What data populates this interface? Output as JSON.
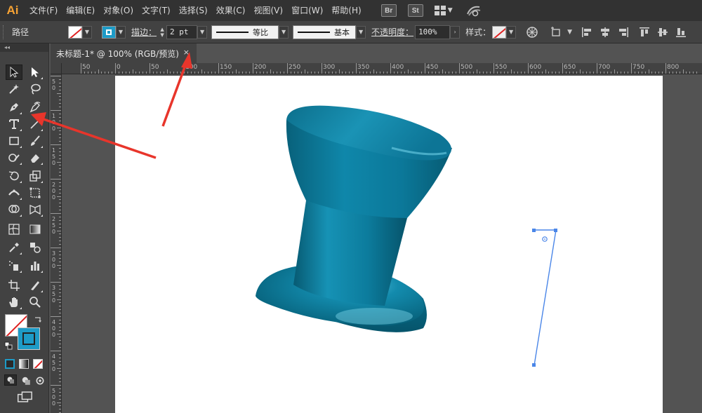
{
  "app": {
    "logo": "Ai"
  },
  "menu": [
    {
      "key": "file",
      "label": "文件(F)"
    },
    {
      "key": "edit",
      "label": "编辑(E)"
    },
    {
      "key": "object",
      "label": "对象(O)"
    },
    {
      "key": "type",
      "label": "文字(T)"
    },
    {
      "key": "select",
      "label": "选择(S)"
    },
    {
      "key": "effect",
      "label": "效果(C)"
    },
    {
      "key": "view",
      "label": "视图(V)"
    },
    {
      "key": "window",
      "label": "窗口(W)"
    },
    {
      "key": "help",
      "label": "帮助(H)"
    }
  ],
  "bridge": {
    "br": "Br",
    "st": "St"
  },
  "control": {
    "selection_label": "路径",
    "stroke_label": "描边",
    "stroke_weight": "2 pt",
    "profile_label": "等比",
    "brush_label": "基本",
    "opacity_label": "不透明度",
    "opacity_value": "100%",
    "style_label": "样式"
  },
  "tab": {
    "title": "未标题-1* @ 100% (RGB/预览)",
    "close": "×"
  },
  "rulers": {
    "h_ticks": [
      "50",
      "0",
      "50",
      "100",
      "150",
      "200",
      "250",
      "300",
      "350",
      "400",
      "450",
      "500",
      "550",
      "600",
      "650",
      "700",
      "750",
      "800"
    ],
    "v_ticks": [
      "5\n0",
      "1\n0\n0",
      "1\n5\n0",
      "2\n0\n0",
      "2\n5\n0",
      "3\n0\n0",
      "3\n5\n0",
      "4\n0\n0",
      "4\n5\n0",
      "5\n0\n0"
    ]
  },
  "colors": {
    "accent_fill": "#1d9bc7",
    "shape_primary": "#0a7fa0",
    "shape_dark": "#065f78",
    "shape_light": "#4fb7d3",
    "selection": "#4a86e8",
    "arrow_red": "#e8352b"
  },
  "tools": [
    {
      "name": "selection-tool-icon"
    },
    {
      "name": "direct-selection-tool-icon"
    },
    {
      "name": "magic-wand-tool-icon"
    },
    {
      "name": "lasso-tool-icon"
    },
    {
      "name": "pen-tool-icon"
    },
    {
      "name": "curvature-tool-icon"
    },
    {
      "name": "type-tool-icon"
    },
    {
      "name": "line-segment-tool-icon"
    },
    {
      "name": "rectangle-tool-icon"
    },
    {
      "name": "paintbrush-tool-icon"
    },
    {
      "name": "shaper-tool-icon"
    },
    {
      "name": "eraser-tool-icon"
    },
    {
      "name": "rotate-tool-icon"
    },
    {
      "name": "scale-tool-icon"
    },
    {
      "name": "width-tool-icon"
    },
    {
      "name": "free-transform-tool-icon"
    },
    {
      "name": "shape-builder-tool-icon"
    },
    {
      "name": "perspective-grid-tool-icon"
    },
    {
      "name": "mesh-tool-icon"
    },
    {
      "name": "gradient-tool-icon"
    },
    {
      "name": "eyedropper-tool-icon"
    },
    {
      "name": "blend-tool-icon"
    },
    {
      "name": "symbol-sprayer-tool-icon"
    },
    {
      "name": "column-graph-tool-icon"
    },
    {
      "name": "artboard-tool-icon"
    },
    {
      "name": "slice-tool-icon"
    },
    {
      "name": "hand-tool-icon"
    },
    {
      "name": "zoom-tool-icon"
    }
  ]
}
